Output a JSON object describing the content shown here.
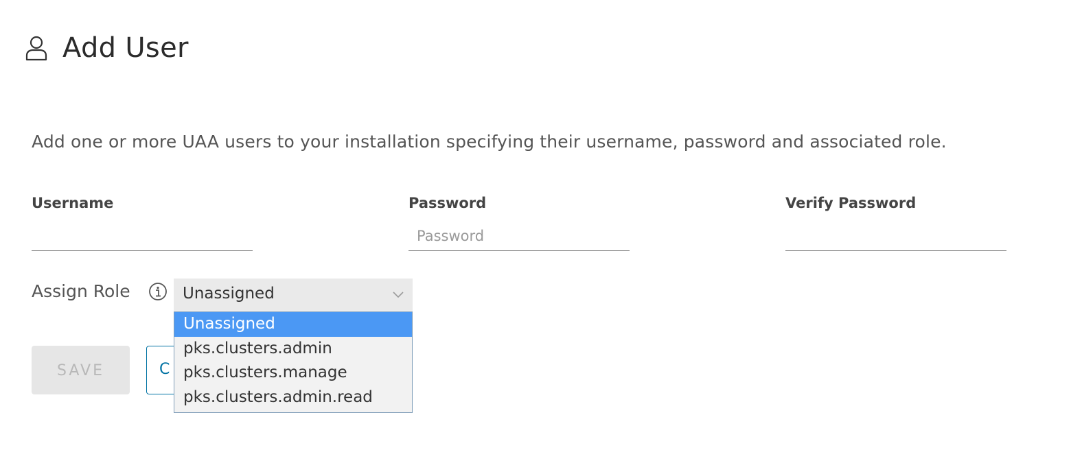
{
  "header": {
    "icon": "user-icon",
    "title": "Add User"
  },
  "description": "Add one or more UAA users to your installation specifying their username, password and associated role.",
  "form": {
    "username": {
      "label": "Username",
      "value": "",
      "placeholder": ""
    },
    "password": {
      "label": "Password",
      "value": "",
      "placeholder": "Password"
    },
    "verify_password": {
      "label": "Verify Password",
      "value": "",
      "placeholder": ""
    },
    "role": {
      "label": "Assign Role",
      "info_icon": "info-icon",
      "selected": "Unassigned",
      "options": [
        "Unassigned",
        "pks.clusters.admin",
        "pks.clusters.manage",
        "pks.clusters.admin.read"
      ],
      "highlighted_option": "Unassigned"
    }
  },
  "actions": {
    "save_label": "SAVE",
    "cancel_label": "C"
  },
  "colors": {
    "accent": "#0072a3",
    "option_highlight": "#4b98f4",
    "select_bg": "#eaeaea",
    "save_bg": "#e6e6e6"
  }
}
